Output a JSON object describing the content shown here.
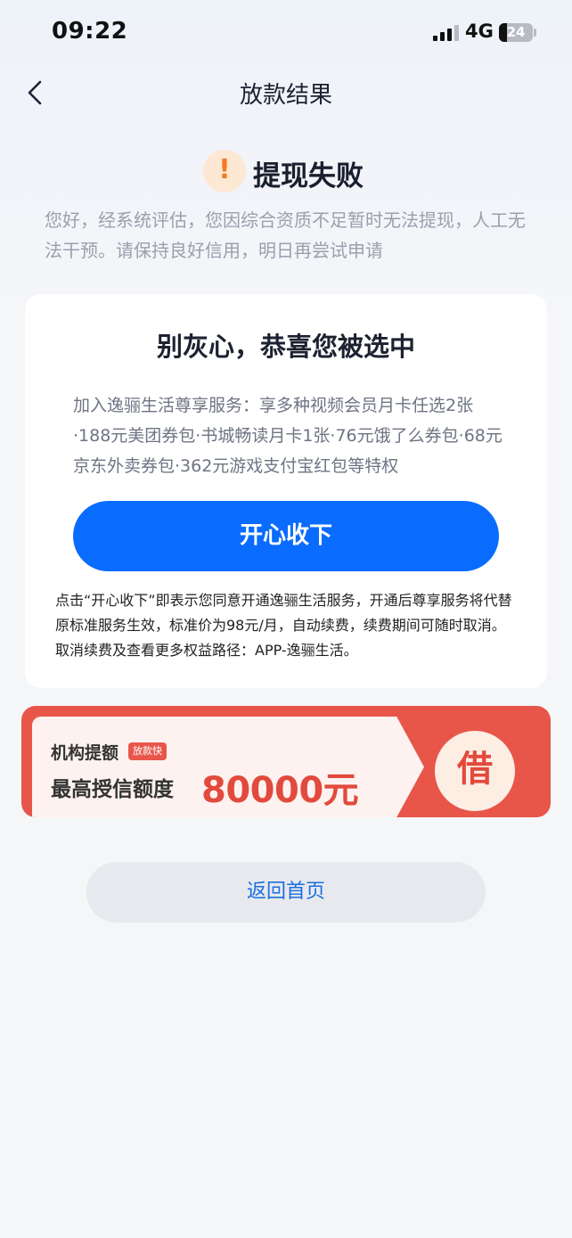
{
  "status_bar": {
    "time": "09:22",
    "network": "4G",
    "battery": "24",
    "battery_level_percent": 24
  },
  "nav": {
    "back_icon": "chevron-left-icon",
    "title": "放款结果"
  },
  "result": {
    "icon": "warning-icon",
    "icon_glyph": "!",
    "title": "提现失败",
    "description": "您好，经系统评估，您因综合资质不足暂时无法提现，人工无法干预。请保持良好信用，明日再尝试申请"
  },
  "offer": {
    "title": "别灰心，恭喜您被选中",
    "description": "加入逸骊生活尊享服务：享多种视频会员月卡任选2张·188元美团券包·书城畅读月卡1张·76元饿了么券包·68元京东外卖券包·362元游戏支付宝红包等特权",
    "accept_label": "开心收下",
    "terms": "点击“开心收下”即表示您同意开通逸骊生活服务，开通后尊享服务将代替原标准服务生效，标准价为98元/月，自动续费，续费期间可随时取消。取消续费及查看更多权益路径：APP-逸骊生活。"
  },
  "banner": {
    "line1": "机构提额",
    "tag": "放款快",
    "label": "最高授信额度",
    "amount": "80000元",
    "action": "借",
    "accent_color": "#e8564a"
  },
  "footer": {
    "home_label": "返回首页"
  },
  "colors": {
    "primary": "#0a6cff",
    "warning": "#f37a1f",
    "link": "#1a6fe0"
  }
}
